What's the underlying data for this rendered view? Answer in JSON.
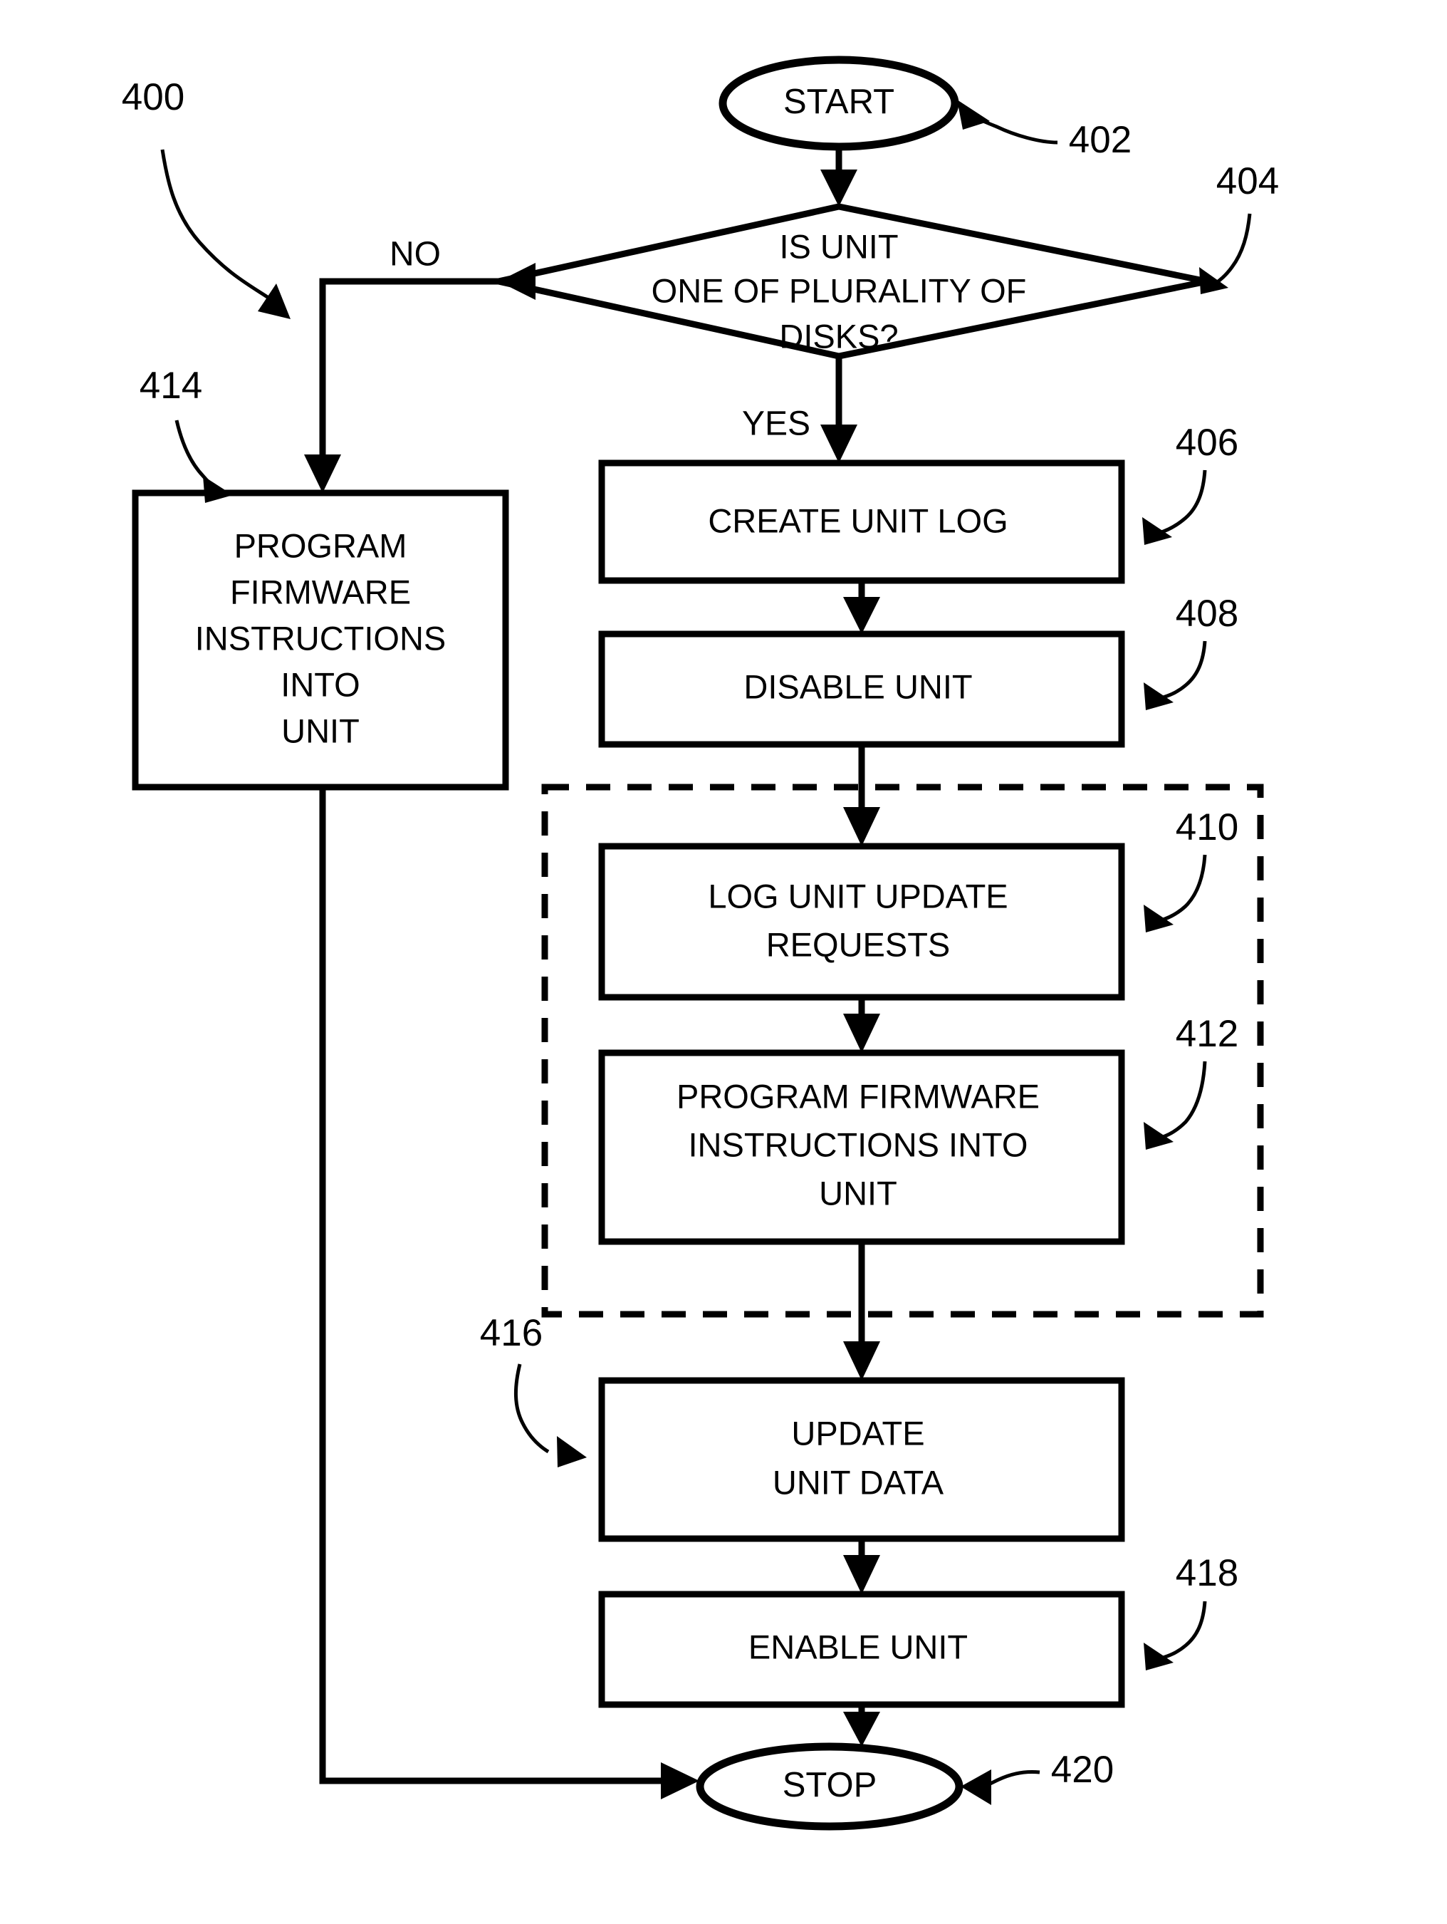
{
  "diagram": {
    "figure_ref": "400",
    "terminals": {
      "start": {
        "label": "START",
        "ref": "402"
      },
      "stop": {
        "label": "STOP",
        "ref": "420"
      }
    },
    "decision": {
      "ref": "404",
      "line1": "IS UNIT",
      "line2": "ONE OF PLURALITY OF",
      "line3": "DISKS?",
      "yes_label": "YES",
      "no_label": "NO"
    },
    "process_boxes": [
      {
        "ref": "406",
        "lines": [
          "CREATE UNIT LOG"
        ]
      },
      {
        "ref": "408",
        "lines": [
          "DISABLE UNIT"
        ]
      },
      {
        "ref": "410",
        "lines": [
          "LOG UNIT UPDATE",
          "REQUESTS"
        ]
      },
      {
        "ref": "412",
        "lines": [
          "PROGRAM FIRMWARE",
          "INSTRUCTIONS INTO",
          "UNIT"
        ]
      },
      {
        "ref": "414",
        "lines": [
          "PROGRAM",
          "FIRMWARE",
          "INSTRUCTIONS",
          "INTO",
          "UNIT"
        ]
      },
      {
        "ref": "416",
        "lines": [
          "UPDATE",
          "UNIT DATA"
        ]
      },
      {
        "ref": "418",
        "lines": [
          "ENABLE UNIT"
        ]
      }
    ],
    "colors": {
      "stroke": "#000000",
      "background": "#ffffff"
    }
  }
}
